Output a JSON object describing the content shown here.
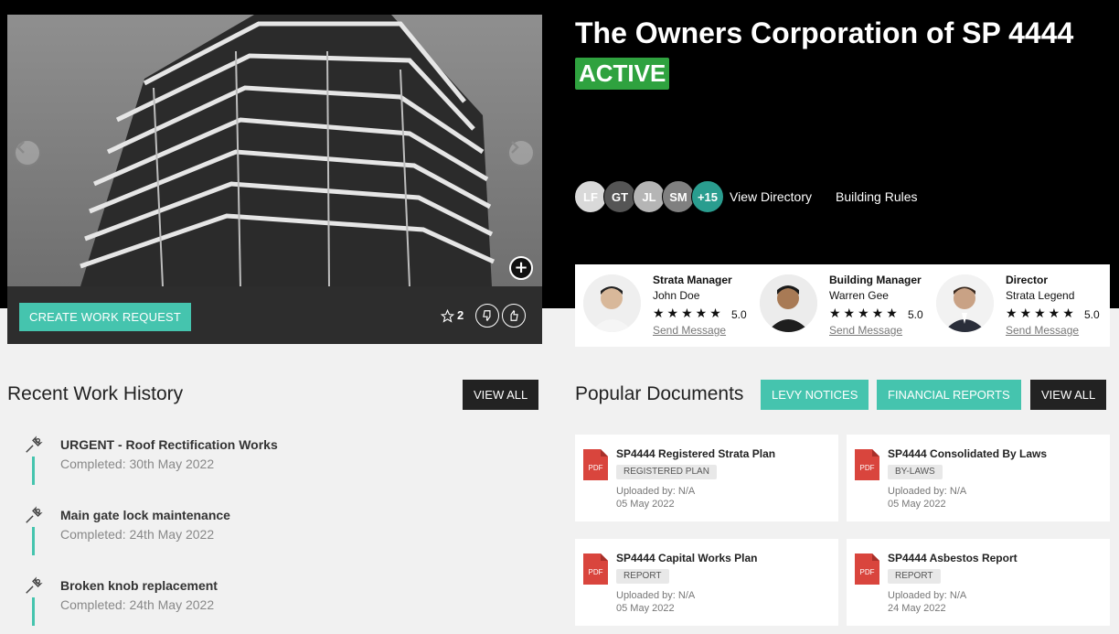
{
  "property": {
    "title": "The Owners Corporation of SP 4444",
    "status": "ACTIVE"
  },
  "gallery": {
    "create_button": "CREATE WORK REQUEST",
    "favourite_count": "2"
  },
  "directory": {
    "avatars": [
      {
        "initials": "LF",
        "color": "#d9d9d9"
      },
      {
        "initials": "GT",
        "color": "#555555"
      },
      {
        "initials": "JL",
        "color": "#b5b5b5"
      },
      {
        "initials": "SM",
        "color": "#808080"
      },
      {
        "initials": "+15",
        "color": "#2a9d8f"
      }
    ],
    "view_directory": "View Directory",
    "building_rules": "Building Rules"
  },
  "managers": [
    {
      "role": "Strata Manager",
      "name": "John Doe",
      "rating": "5.0",
      "stars": "★★★★★",
      "action": "Send Message"
    },
    {
      "role": "Building Manager",
      "name": "Warren Gee",
      "rating": "5.0",
      "stars": "★★★★★",
      "action": "Send Message"
    },
    {
      "role": "Director",
      "name": "Strata Legend",
      "rating": "5.0",
      "stars": "★★★★★",
      "action": "Send Message"
    }
  ],
  "work_history": {
    "heading": "Recent Work History",
    "view_all": "VIEW ALL",
    "items": [
      {
        "title": "URGENT - Roof Rectification Works",
        "completed": "Completed: 30th May 2022"
      },
      {
        "title": "Main gate lock maintenance",
        "completed": "Completed: 24th May 2022"
      },
      {
        "title": "Broken knob replacement",
        "completed": "Completed: 24th May 2022"
      }
    ]
  },
  "documents": {
    "heading": "Popular Documents",
    "filter_levy": "LEVY NOTICES",
    "filter_financial": "FINANCIAL REPORTS",
    "view_all": "VIEW ALL",
    "pdf_label": "PDF",
    "items": [
      {
        "title": "SP4444 Registered Strata Plan",
        "tag": "REGISTERED PLAN",
        "uploaded": "Uploaded by: N/A",
        "date": "05 May 2022"
      },
      {
        "title": "SP4444 Consolidated By Laws",
        "tag": "BY-LAWS",
        "uploaded": "Uploaded by: N/A",
        "date": "05 May 2022"
      },
      {
        "title": "SP4444 Capital Works Plan",
        "tag": "REPORT",
        "uploaded": "Uploaded by: N/A",
        "date": "05 May 2022"
      },
      {
        "title": "SP4444 Asbestos Report",
        "tag": "REPORT",
        "uploaded": "Uploaded by: N/A",
        "date": "24 May 2022"
      }
    ]
  },
  "colors": {
    "accent": "#45c4ae",
    "active": "#2fa23f",
    "pdf": "#d9453d"
  }
}
